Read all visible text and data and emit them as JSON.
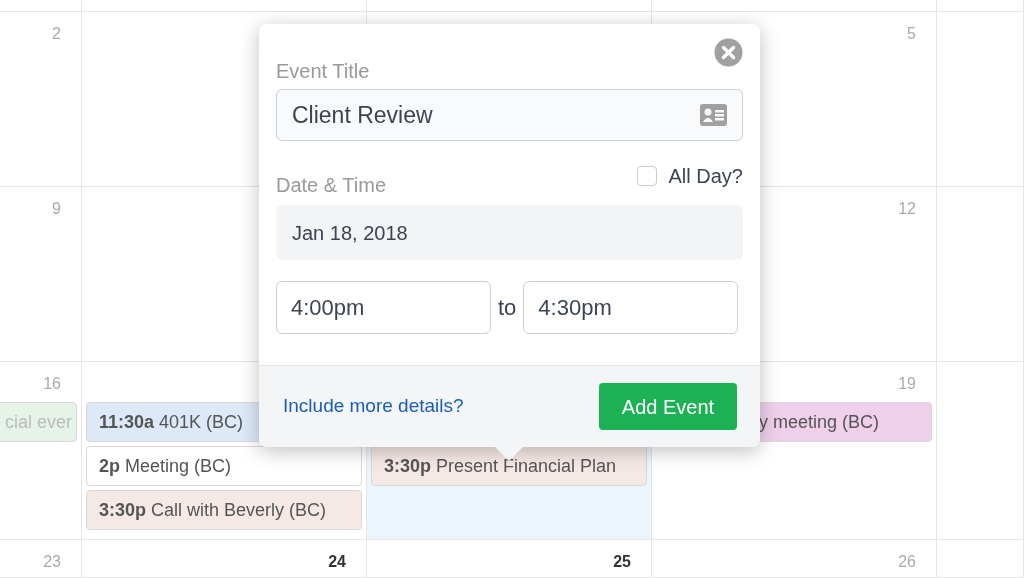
{
  "calendar": {
    "weeks": [
      {
        "column_1": {
          "day": "2",
          "selected": false,
          "emphasized": false
        },
        "column_4": {
          "day": "5",
          "selected": false,
          "emphasized": false
        }
      },
      {
        "column_1": {
          "day": "9",
          "selected": false,
          "emphasized": false
        },
        "column_4": {
          "day": "12",
          "selected": false,
          "emphasized": false
        }
      },
      {
        "column_1": {
          "day": "16",
          "selected": false,
          "emphasized": false,
          "events": [
            {
              "title": "cial ever",
              "color": "#e6f3e8"
            }
          ]
        },
        "column_2": {
          "selected": false,
          "events": [
            {
              "time": "11:30a",
              "title": "401K (BC)",
              "color": "#dde9f8"
            },
            {
              "time": "2p",
              "title": "Meeting (BC)",
              "color": "#ffffff"
            },
            {
              "time": "3:30p",
              "title": "Call with Beverly (BC)",
              "color": "#f5e9e6"
            }
          ]
        },
        "column_3": {
          "selected": true,
          "events": [
            {
              "time": "3:30p",
              "title": "Present Financial Plan",
              "color": "#f5e9e6"
            }
          ]
        },
        "column_4": {
          "day": "19",
          "selected": false,
          "emphasized": false,
          "events": [
            {
              "title": "y meeting (BC)",
              "color": "#efd0ea"
            }
          ]
        }
      },
      {
        "column_1": {
          "day": "23",
          "selected": false,
          "emphasized": false
        },
        "column_2": {
          "day": "24",
          "selected": false,
          "emphasized": true
        },
        "column_3": {
          "day": "25",
          "selected": false,
          "emphasized": true
        },
        "column_4": {
          "day": "26",
          "selected": false,
          "emphasized": false
        }
      }
    ]
  },
  "popup": {
    "title_label": "Event Title",
    "title_value": "Client Review",
    "date_label": "Date & Time",
    "all_day": {
      "label": "All Day?",
      "checked": false
    },
    "date": "Jan 18, 2018",
    "start": "4:00pm",
    "separator": "to",
    "end": "4:30pm",
    "link": "Include more details?",
    "button": "Add Event"
  }
}
